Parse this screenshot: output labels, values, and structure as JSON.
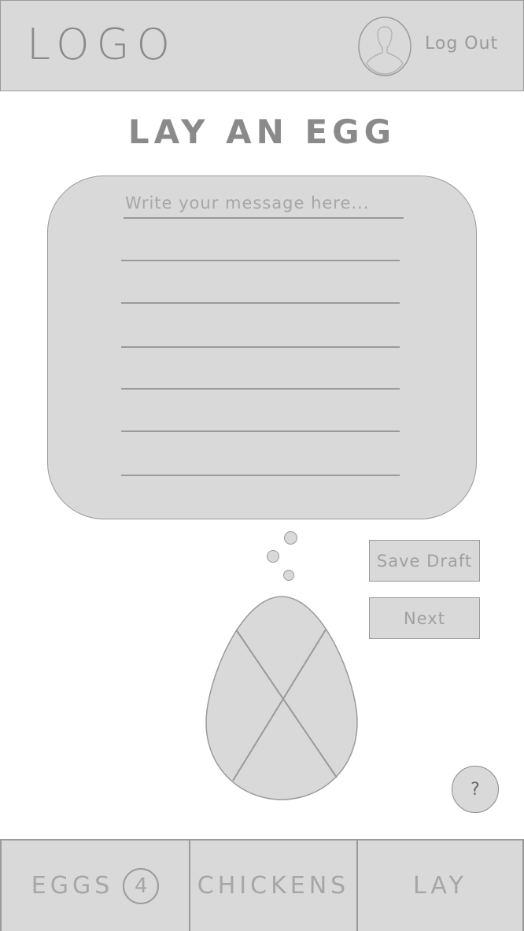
{
  "header": {
    "logo": "LOGO",
    "avatar_icon": "user-silhouette-icon",
    "logout_label": "Log Out"
  },
  "page": {
    "title": "LAY AN EGG"
  },
  "composer": {
    "placeholder": "Write your message here...",
    "value": "",
    "save_draft_label": "Save Draft",
    "next_label": "Next"
  },
  "illustration": {
    "egg_icon": "egg-icon",
    "bubbles_icon": "thought-bubble-icon"
  },
  "help": {
    "label": "?"
  },
  "tabs": [
    {
      "label": "EGGS",
      "count": "4"
    },
    {
      "label": "CHICKENS"
    },
    {
      "label": "LAY"
    }
  ],
  "colors": {
    "fill": "#d9d9d9",
    "stroke": "#9a9a9a",
    "text": "#8a8a8a",
    "background": "#ffffff"
  }
}
